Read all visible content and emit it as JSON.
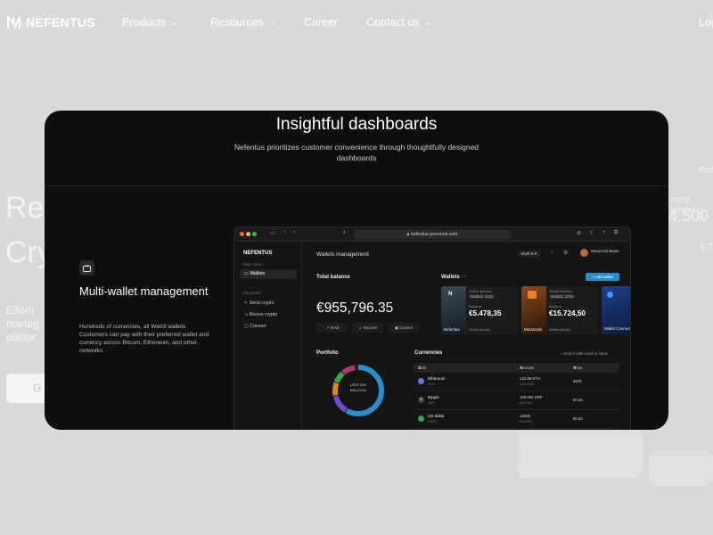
{
  "brand": {
    "name": "NEFENTUS"
  },
  "nav": {
    "products": "Products",
    "resources": "Resources",
    "career": "Career",
    "contact": "Contact us",
    "login": "Log"
  },
  "background": {
    "hero_line1": "Rev",
    "hero_line2": "Cry",
    "para_line1": "Effortl",
    "para_line2": "manag",
    "para_line3": "platfor",
    "button": "G",
    "right_1": "Rob",
    "right_2": "nent amou",
    "right_3": "4,500",
    "right_4": "ETH"
  },
  "modal": {
    "title": "Insightful dashboards",
    "subtitle": "Nefentus prioritizes customer convenience through thoughtfully designed dashboards",
    "feature_title": "Multi-wallet management",
    "feature_desc": "Hundreds of currencies, all Web3 wallets. Customers can pay with their preferred wallet and currency across Bitcoin, Ethereum, and other networks"
  },
  "browser": {
    "url": "nefentus-personal.com"
  },
  "app": {
    "logo": "NEFENTUS",
    "main_menu": "Main menu",
    "wallets_item": "Wallets",
    "payments": "Payments",
    "send_crypto": "Send crypto",
    "receive_crypto": "Recive crypto",
    "convert": "Convert",
    "page_title": "Wallets management",
    "currency_selector": "EUR €",
    "user_name": "Wuxia Kid Boxer",
    "total_balance_label": "Total balance",
    "total_balance": "€955,796.35",
    "actions": [
      "Send",
      "Receive",
      "Convert"
    ],
    "wallets_label": "Wallets",
    "add_wallet": "+ Add wallet",
    "wallets": [
      {
        "name": "Nefentus",
        "address_label": "Wallet address",
        "address": "0xabcd..1234",
        "balance_label": "Balance",
        "balance": "€5.478,35",
        "footer": "Wallet details"
      },
      {
        "name": "Metamask",
        "address_label": "Wallet address",
        "address": "0xabcd..1234",
        "balance_label": "Balance",
        "balance": "€15.724,50",
        "footer": "Wallet details"
      },
      {
        "name": "Wallet Connect"
      }
    ],
    "portfolio_label": "Portfolio",
    "donut_line1": "USDT 10%",
    "donut_line2": "€95,474.50",
    "currencies_label": "Currencies",
    "search_placeholder": "Search with email or name",
    "columns": [
      "Coin",
      "Amount",
      "Price"
    ],
    "rows": [
      {
        "coin": "Ethereum",
        "symbol": "ETH",
        "amount": "142.88 ETH",
        "amount_eur": "€220,000",
        "price": "€376"
      },
      {
        "coin": "Ripple",
        "symbol": "XRP",
        "amount": "100.000 XRP",
        "amount_eur": "€45,000",
        "price": "€0.45"
      },
      {
        "coin": "US dollar",
        "symbol": "USDT",
        "amount": "12000",
        "amount_eur": "€10,000",
        "price": "€0.92"
      }
    ]
  },
  "colors": {
    "accent": "#2a8fc9",
    "card_bg": "#0e0e0e",
    "page_bg": "#d9d9d9"
  }
}
